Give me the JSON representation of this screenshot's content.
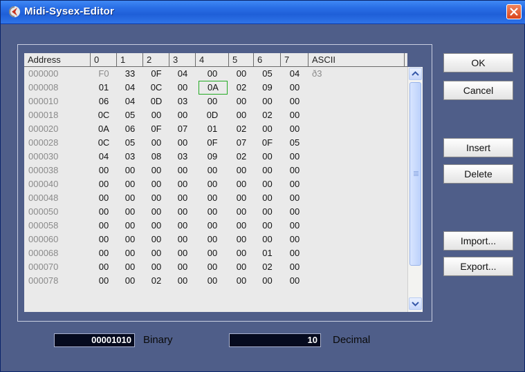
{
  "window": {
    "title": "Midi-Sysex-Editor"
  },
  "table": {
    "headers": [
      "Address",
      "0",
      "1",
      "2",
      "3",
      "4",
      "5",
      "6",
      "7",
      "ASCII"
    ],
    "rows": [
      {
        "address": "000000",
        "bytes": [
          "F0",
          "33",
          "0F",
          "04",
          "00",
          "00",
          "05",
          "04"
        ],
        "ascii": "ð3"
      },
      {
        "address": "000008",
        "bytes": [
          "01",
          "04",
          "0C",
          "00",
          "0A",
          "02",
          "09",
          "00"
        ],
        "ascii": ""
      },
      {
        "address": "000010",
        "bytes": [
          "06",
          "04",
          "0D",
          "03",
          "00",
          "00",
          "00",
          "00"
        ],
        "ascii": ""
      },
      {
        "address": "000018",
        "bytes": [
          "0C",
          "05",
          "00",
          "00",
          "0D",
          "00",
          "02",
          "00"
        ],
        "ascii": ""
      },
      {
        "address": "000020",
        "bytes": [
          "0A",
          "06",
          "0F",
          "07",
          "01",
          "02",
          "00",
          "00"
        ],
        "ascii": ""
      },
      {
        "address": "000028",
        "bytes": [
          "0C",
          "05",
          "00",
          "00",
          "0F",
          "07",
          "0F",
          "05"
        ],
        "ascii": ""
      },
      {
        "address": "000030",
        "bytes": [
          "04",
          "03",
          "08",
          "03",
          "09",
          "02",
          "00",
          "00"
        ],
        "ascii": ""
      },
      {
        "address": "000038",
        "bytes": [
          "00",
          "00",
          "00",
          "00",
          "00",
          "00",
          "00",
          "00"
        ],
        "ascii": ""
      },
      {
        "address": "000040",
        "bytes": [
          "00",
          "00",
          "00",
          "00",
          "00",
          "00",
          "00",
          "00"
        ],
        "ascii": ""
      },
      {
        "address": "000048",
        "bytes": [
          "00",
          "00",
          "00",
          "00",
          "00",
          "00",
          "00",
          "00"
        ],
        "ascii": ""
      },
      {
        "address": "000050",
        "bytes": [
          "00",
          "00",
          "00",
          "00",
          "00",
          "00",
          "00",
          "00"
        ],
        "ascii": ""
      },
      {
        "address": "000058",
        "bytes": [
          "00",
          "00",
          "00",
          "00",
          "00",
          "00",
          "00",
          "00"
        ],
        "ascii": ""
      },
      {
        "address": "000060",
        "bytes": [
          "00",
          "00",
          "00",
          "00",
          "00",
          "00",
          "00",
          "00"
        ],
        "ascii": ""
      },
      {
        "address": "000068",
        "bytes": [
          "00",
          "00",
          "00",
          "00",
          "00",
          "00",
          "01",
          "00"
        ],
        "ascii": ""
      },
      {
        "address": "000070",
        "bytes": [
          "00",
          "00",
          "00",
          "00",
          "00",
          "00",
          "02",
          "00"
        ],
        "ascii": ""
      },
      {
        "address": "000078",
        "bytes": [
          "00",
          "00",
          "02",
          "00",
          "00",
          "00",
          "00",
          "00"
        ],
        "ascii": ""
      }
    ],
    "selected_cell": {
      "row": 1,
      "col": 4
    }
  },
  "buttons": {
    "ok": "OK",
    "cancel": "Cancel",
    "insert": "Insert",
    "delete": "Delete",
    "import": "Import...",
    "export": "Export..."
  },
  "value_display": {
    "binary_value": "00001010",
    "binary_label": "Binary",
    "decimal_value": "10",
    "decimal_label": "Decimal"
  },
  "icons": {
    "app": "cubase-icon",
    "close": "close-icon",
    "scroll_up": "chevron-up-icon",
    "scroll_down": "chevron-down-icon"
  },
  "colors": {
    "background": "#4f5e89",
    "grid": "#eaeaea",
    "selection_outline": "#22aa22",
    "titlebar": "#2a6fe6"
  }
}
